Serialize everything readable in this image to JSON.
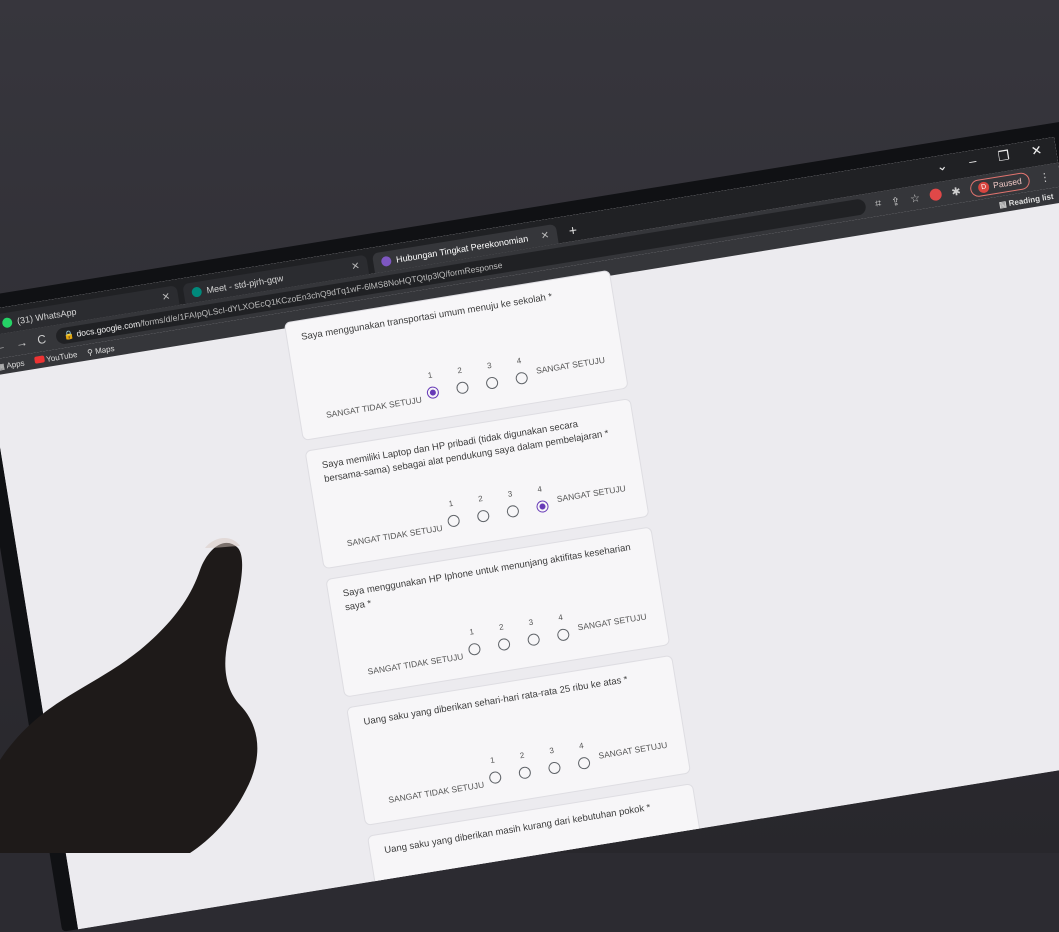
{
  "tabs": [
    {
      "label": "(31) WhatsApp",
      "color": "#25d366"
    },
    {
      "label": "Meet - std-pjrh-gqw",
      "color": "#00897b"
    },
    {
      "label": "Hubungan Tingkat Perekonomian",
      "color": "#7e57c2"
    }
  ],
  "new_tab": "+",
  "window_controls": [
    "⌄",
    "–",
    "❐",
    "✕"
  ],
  "toolbar": {
    "back": "←",
    "forward": "→",
    "reload": "C",
    "url_host": "docs.google.com",
    "url_path": "/forms/d/e/1FAIpQLScI-dYLXOEcQ1KCzoEn3chQ9dTq1wF-6lMS8NoHQTQtIp3lQ/formResponse",
    "paused_initial": "D",
    "paused_label": "Paused"
  },
  "bookmarks": {
    "apps": "Apps",
    "youtube": "YouTube",
    "maps": "Maps",
    "reading_list": "Reading list"
  },
  "form": {
    "scale_numbers": [
      "1",
      "2",
      "3",
      "4"
    ],
    "left_label": "SANGAT TIDAK SETUJU",
    "right_label": "SANGAT SETUJU",
    "questions": [
      {
        "text": "Saya menggunakan transportasi umum menuju ke sekolah *",
        "selected": 1
      },
      {
        "text": "Saya memiliki Laptop dan HP pribadi (tidak digunakan secara bersama-sama) sebagai alat pendukung saya dalam pembelajaran *",
        "selected": 4
      },
      {
        "text": "Saya menggunakan HP Iphone untuk menunjang aktifitas keseharian saya *",
        "selected": 0
      },
      {
        "text": "Uang saku yang diberikan sehari-hari rata-rata 25 ribu ke atas *",
        "selected": 0
      },
      {
        "text": "Uang saku yang diberikan masih kurang dari kebutuhan pokok *",
        "selected": 0
      }
    ]
  },
  "colors": {
    "accent": "#673ab7",
    "chrome_dark": "#35363a"
  }
}
